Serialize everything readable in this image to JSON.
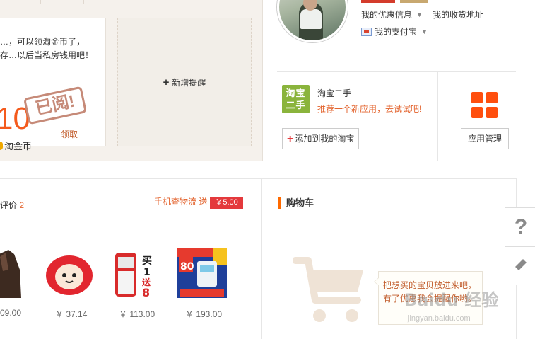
{
  "reminder": {
    "coin_text": "…，可以领淘金币了，存…以后当私房钱用吧！",
    "coin_amount": "10",
    "stamp": "已阅!",
    "claim_link": "领取",
    "coin_brand": "淘金币",
    "add_reminder": "新增提醒"
  },
  "profile": {
    "my_coupons": "我的优惠信息",
    "my_address": "我的收货地址",
    "my_alipay": "我的支付宝"
  },
  "app": {
    "icon_text_line1": "淘宝",
    "icon_text_line2": "二手",
    "name": "淘宝二手",
    "desc": "推荐一个新应用，去试试吧!",
    "add_button": "添加到我的淘宝",
    "manage_button": "应用管理"
  },
  "orders": {
    "review_label": "评价",
    "review_count": "2",
    "promo_text": "手机查物流 送",
    "promo_badge": "￥5.00",
    "products": [
      {
        "name": "jacket",
        "price": "09.00"
      },
      {
        "name": "cat-pillow",
        "price": "￥ 37.14"
      },
      {
        "name": "senior-phone",
        "price": "￥ 113.00",
        "overlay": "买1送8"
      },
      {
        "name": "blood-pressure-monitor",
        "price": "￥ 193.00",
        "overlay": "80"
      }
    ]
  },
  "cart": {
    "title": "购物车",
    "tip": "把想买的宝贝放进来吧，有了优惠我会提醒你哟。"
  },
  "side": {
    "help_glyph": "?"
  },
  "watermark": {
    "main": "Baidu 经验",
    "sub": "jingyan.baidu.com"
  }
}
